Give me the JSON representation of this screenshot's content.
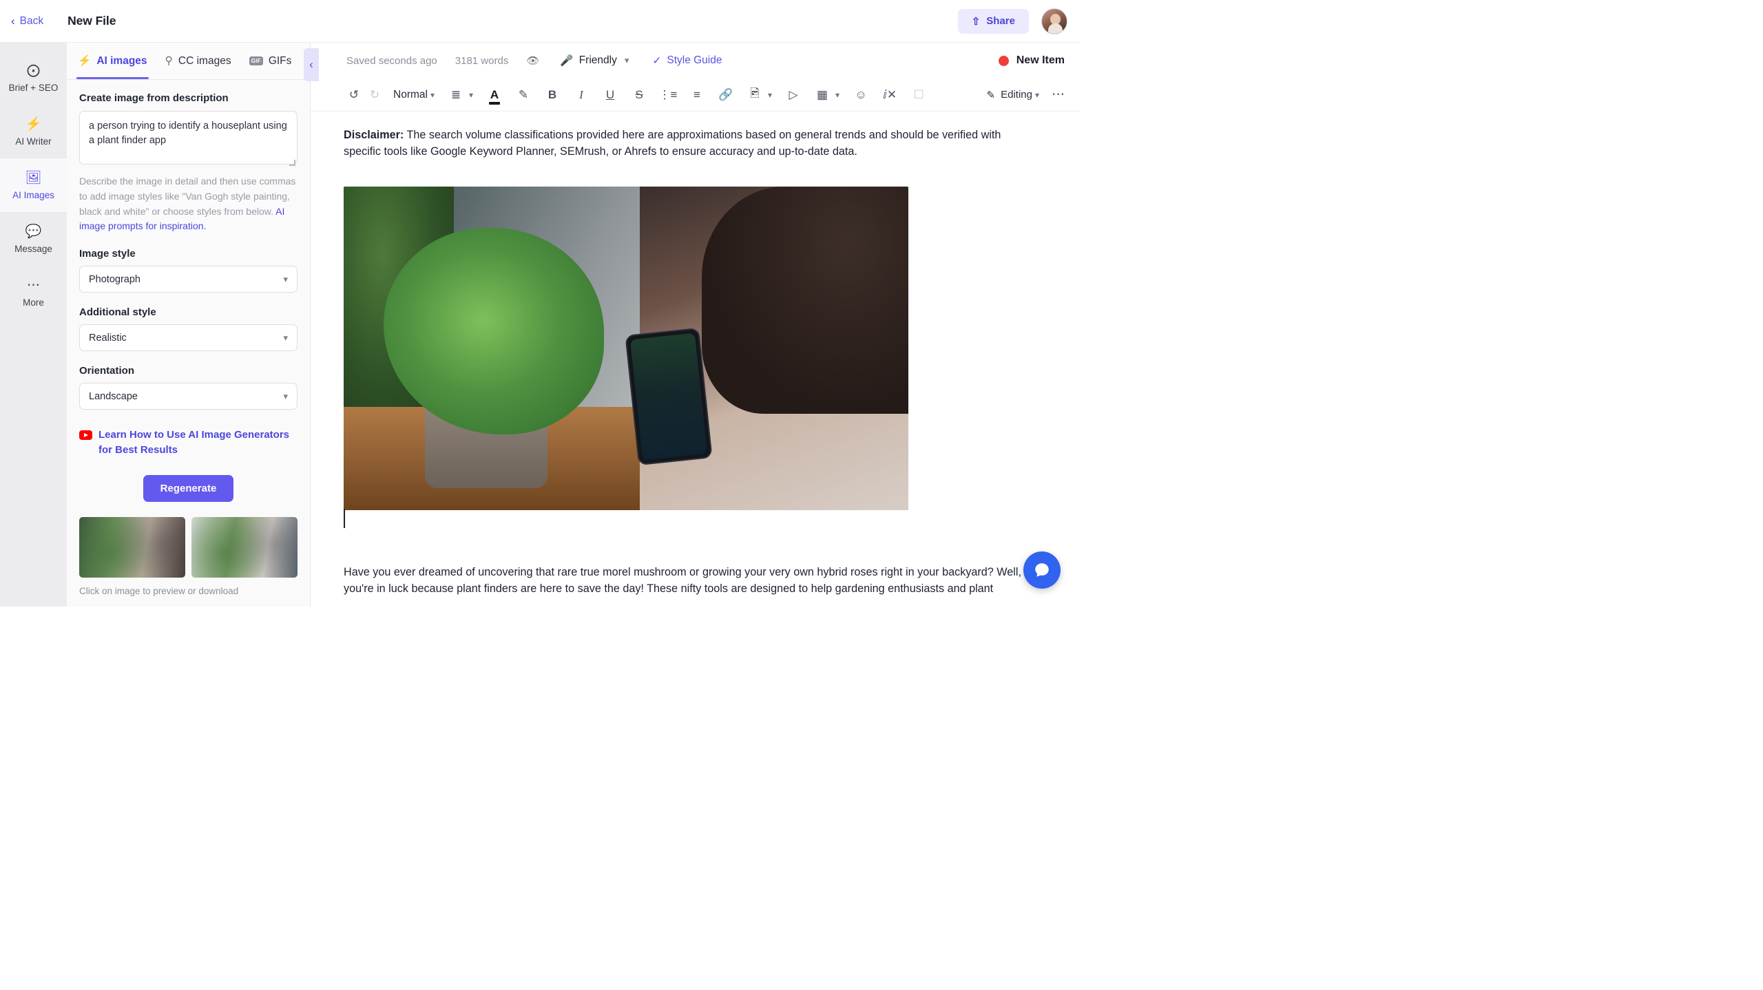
{
  "topbar": {
    "back_label": "Back",
    "file_title": "New File",
    "share_label": "Share"
  },
  "rail": {
    "items": [
      {
        "label": "Brief + SEO",
        "icon": "target-icon",
        "active": false
      },
      {
        "label": "AI Writer",
        "icon": "lightning-icon",
        "active": false
      },
      {
        "label": "AI Images",
        "icon": "image-icon",
        "active": true
      },
      {
        "label": "Message",
        "icon": "chat-icon",
        "active": false
      },
      {
        "label": "More",
        "icon": "ellipsis-icon",
        "active": false
      }
    ]
  },
  "panel": {
    "tabs": [
      {
        "label": "AI images",
        "icon": "lightning-icon",
        "active": true
      },
      {
        "label": "CC images",
        "icon": "search-icon",
        "active": false
      },
      {
        "label": "GIFs",
        "icon": "gif-icon",
        "active": false
      }
    ],
    "prompt_label": "Create image from description",
    "prompt_value": "a person trying to identify a houseplant using a plant finder app",
    "hint_text": "Describe the image in detail and then use commas to add image styles like \"Van Gogh style painting, black and white\" or choose styles from below. ",
    "hint_link": "AI image prompts for inspiration.",
    "image_style_label": "Image style",
    "image_style_value": "Photograph",
    "additional_style_label": "Additional style",
    "additional_style_value": "Realistic",
    "orientation_label": "Orientation",
    "orientation_value": "Landscape",
    "learn_text": "Learn How to Use AI Image Generators for Best Results",
    "regenerate_label": "Regenerate",
    "thumbs_caption": "Click on image to preview or download"
  },
  "editor": {
    "saved_text": "Saved seconds ago",
    "word_count": "3181 words",
    "tone_label": "Friendly",
    "style_guide_label": "Style Guide",
    "new_item_label": "New Item",
    "toolbar": {
      "undo": "undo-icon",
      "redo": "redo-icon",
      "block_style": "Normal",
      "editing_label": "Editing"
    }
  },
  "document": {
    "disclaimer_label": "Disclaimer:",
    "disclaimer_text": " The search volume classifications provided here are approximations based on general trends and should be verified with specific tools like Google Keyword Planner, SEMrush, or Ahrefs to ensure accuracy and up-to-date data.",
    "body_paragraph": "Have you ever dreamed of uncovering that rare true morel mushroom or growing your very own hybrid roses right in your backyard? Well, you're in luck because plant finders are here to save the day! These nifty tools are designed to help gardening enthusiasts and plant"
  },
  "colors": {
    "accent": "#4b46dc",
    "accent_button": "#6459ef",
    "accent_soft": "#eceaff",
    "status_red": "#f03e3e",
    "chat_blue": "#3063f0"
  }
}
